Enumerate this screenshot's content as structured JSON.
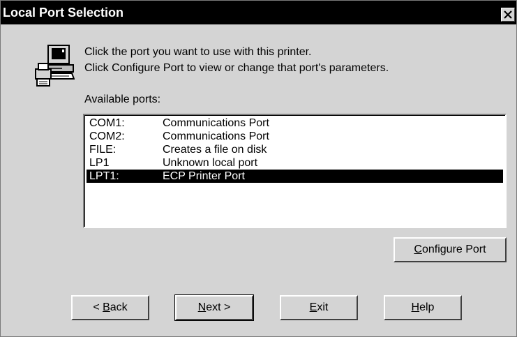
{
  "dialog": {
    "title": "Local Port Selection"
  },
  "instructions": {
    "line1": "Click the port you want to use with this printer.",
    "line2": "Click Configure Port to view or change that port's parameters."
  },
  "ports_label": "Available ports:",
  "ports": [
    {
      "name": "COM1:",
      "description": "Communications Port",
      "selected": false
    },
    {
      "name": "COM2:",
      "description": "Communications Port",
      "selected": false
    },
    {
      "name": "FILE:",
      "description": "Creates a file on disk",
      "selected": false
    },
    {
      "name": "LP1",
      "description": "Unknown local port",
      "selected": false
    },
    {
      "name": "LPT1:",
      "description": "ECP Printer Port",
      "selected": true
    }
  ],
  "buttons": {
    "configure": {
      "pre": "",
      "key": "C",
      "post": "onfigure Port"
    },
    "back": {
      "pre": "< ",
      "key": "B",
      "post": "ack"
    },
    "next": {
      "pre": "",
      "key": "N",
      "post": "ext >"
    },
    "exit": {
      "pre": "",
      "key": "E",
      "post": "xit"
    },
    "help": {
      "pre": "",
      "key": "H",
      "post": "elp"
    }
  },
  "icons": {
    "printer": "printer-computer-icon",
    "close": "close-icon"
  },
  "colors": {
    "face": "#d4d4d4",
    "titlebar": "#000000",
    "selection": "#000000"
  }
}
